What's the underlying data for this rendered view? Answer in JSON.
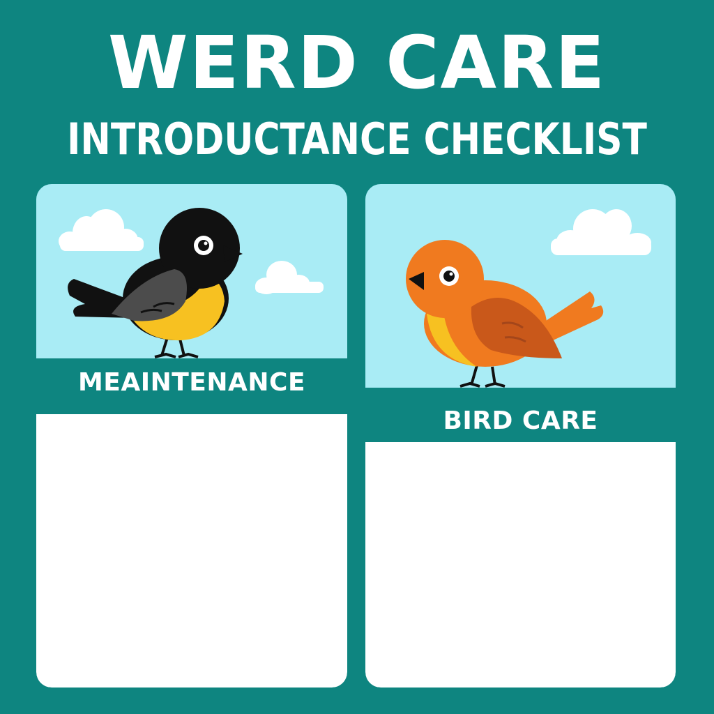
{
  "header": {
    "title": "WERD CARE",
    "subtitle": "INTRODUCTANCE CHECKLIST"
  },
  "cards": [
    {
      "label": "MEAINTENANCE",
      "illustration": "black-and-yellow-bird-icon"
    },
    {
      "label": "BIRD CARE",
      "illustration": "orange-bird-icon"
    }
  ],
  "colors": {
    "background": "#0e8580",
    "sky": "#a9ecf5",
    "panel": "#ffffff",
    "text": "#ffffff"
  }
}
